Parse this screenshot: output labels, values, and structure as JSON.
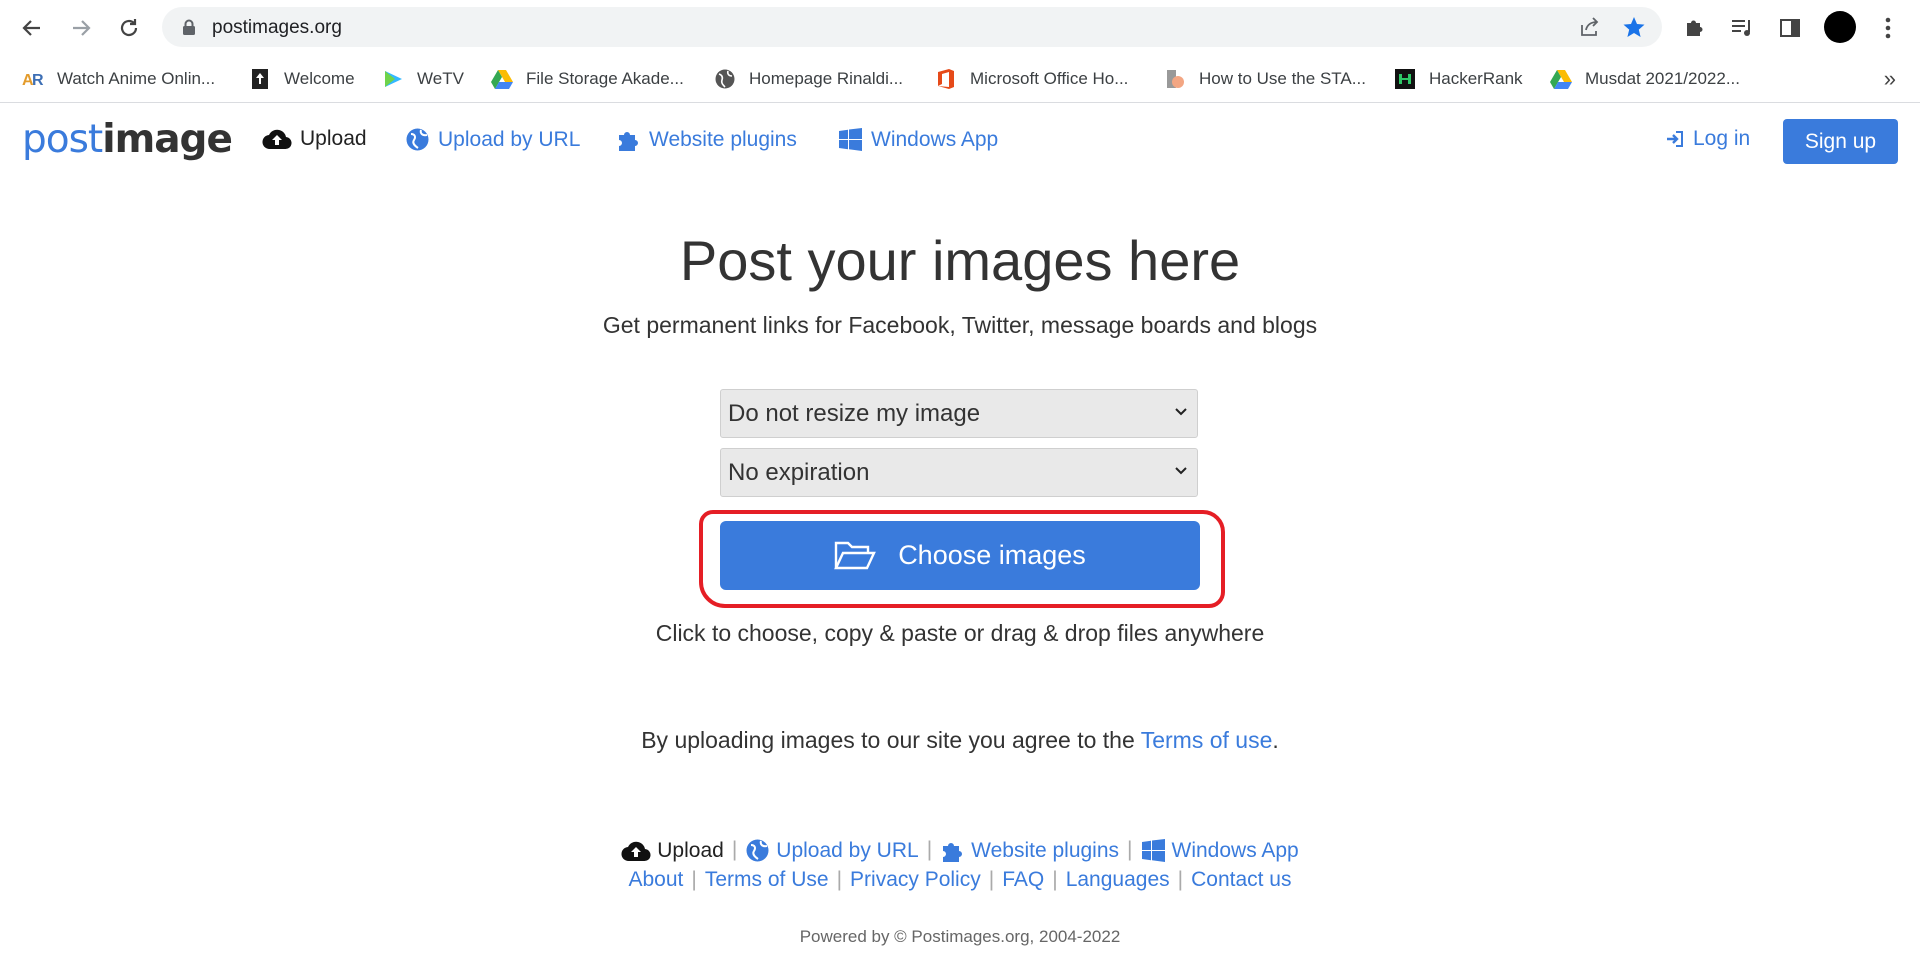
{
  "browser": {
    "url": "postimages.org",
    "bookmarks": [
      {
        "label": "Watch Anime Onlin...",
        "icon": "anime-site-icon"
      },
      {
        "label": "Welcome",
        "icon": "welcome-page-icon"
      },
      {
        "label": "WeTV",
        "icon": "wetv-icon"
      },
      {
        "label": "File Storage Akade...",
        "icon": "google-drive-icon"
      },
      {
        "label": "Homepage Rinaldi...",
        "icon": "globe-icon"
      },
      {
        "label": "Microsoft Office Ho...",
        "icon": "office-icon"
      },
      {
        "label": "How to Use the STA...",
        "icon": "article-icon"
      },
      {
        "label": "HackerRank",
        "icon": "hackerrank-icon"
      },
      {
        "label": "Musdat 2021/2022...",
        "icon": "google-drive-icon"
      }
    ],
    "more_bookmarks": "»"
  },
  "site": {
    "logo_post": "post",
    "logo_image": "image",
    "nav": {
      "upload": "Upload",
      "upload_by_url": "Upload by URL",
      "website_plugins": "Website plugins",
      "windows_app": "Windows App",
      "login": "Log in",
      "signup": "Sign up"
    }
  },
  "main": {
    "title": "Post your images here",
    "subtitle": "Get permanent links for Facebook, Twitter, message boards and blogs",
    "resize_select": "Do not resize my image",
    "expiration_select": "No expiration",
    "choose_button": "Choose images",
    "hint": "Click to choose, copy & paste or drag & drop files anywhere",
    "terms_prefix": "By uploading images to our site you agree to the ",
    "terms_link": "Terms of use",
    "terms_suffix": "."
  },
  "footer": {
    "row1": {
      "upload": "Upload",
      "upload_by_url": "Upload by URL",
      "website_plugins": "Website plugins",
      "windows_app": "Windows App"
    },
    "row2": {
      "about": "About",
      "terms": "Terms of Use",
      "privacy": "Privacy Policy",
      "faq": "FAQ",
      "languages": "Languages",
      "contact": "Contact us"
    },
    "separator": "|",
    "powered": "Powered by © Postimages.org, 2004-2022"
  },
  "colors": {
    "accent": "#3a7bdc",
    "highlight": "#e51e25"
  }
}
